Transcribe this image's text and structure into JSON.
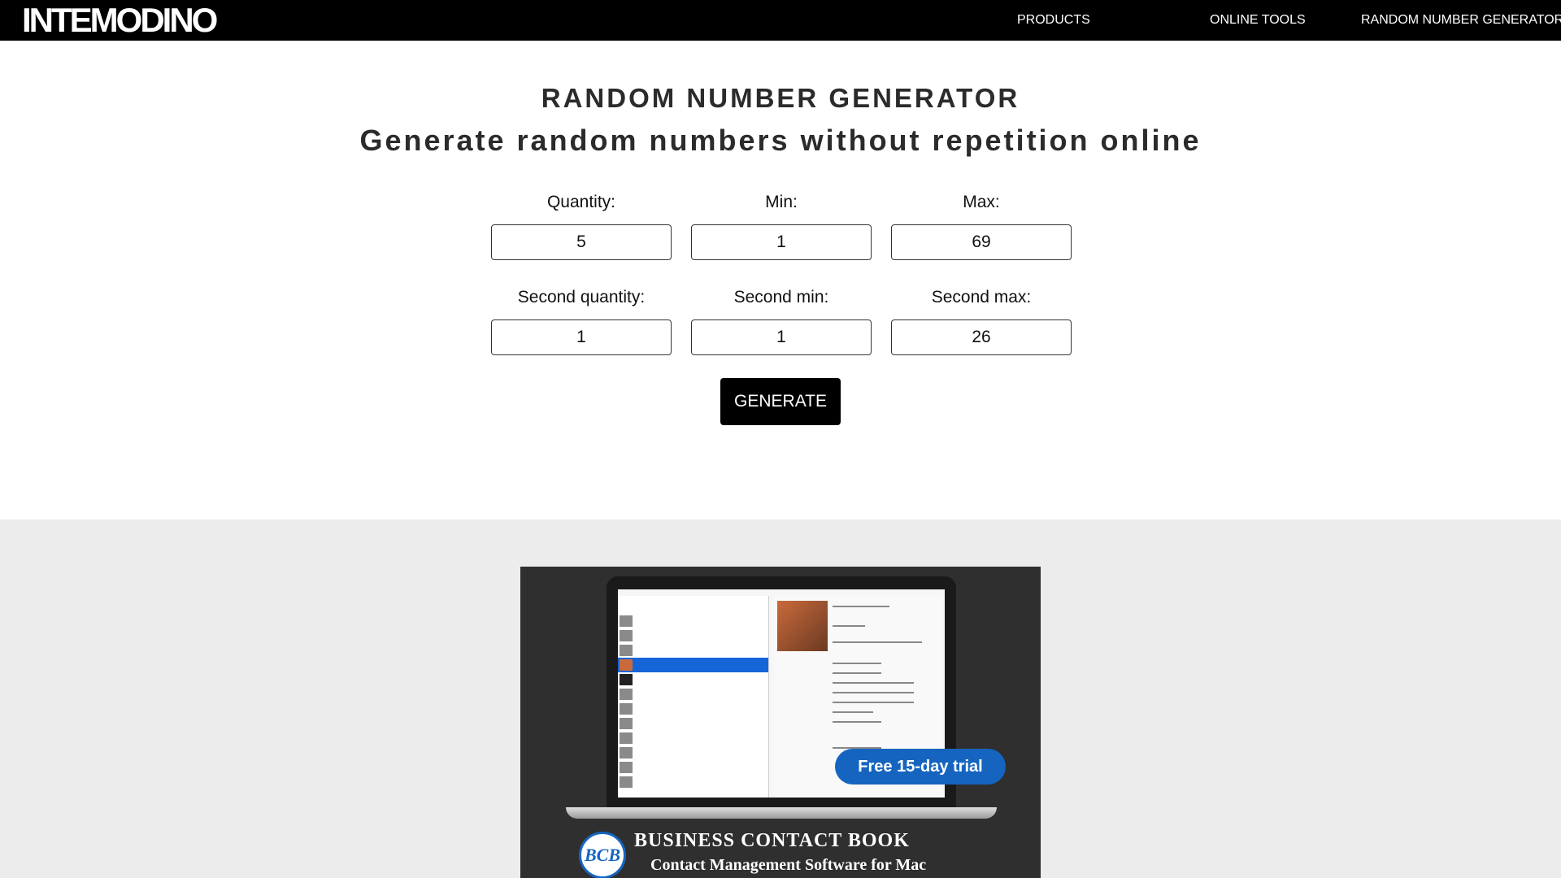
{
  "header": {
    "logo": "INTEMODINO",
    "nav": [
      "PRODUCTS",
      "ONLINE TOOLS",
      "RANDOM NUMBER GENERATOR"
    ]
  },
  "main": {
    "title": "RANDOM NUMBER GENERATOR",
    "subtitle": "Generate random numbers without repetition online",
    "fields": [
      {
        "label": "Quantity:",
        "value": "5"
      },
      {
        "label": "Min:",
        "value": "1"
      },
      {
        "label": "Max:",
        "value": "69"
      },
      {
        "label": "Second quantity:",
        "value": "1"
      },
      {
        "label": "Second min:",
        "value": "1"
      },
      {
        "label": "Second max:",
        "value": "26"
      }
    ],
    "generate_label": "GENERATE"
  },
  "ad": {
    "trial_label": "Free 15-day trial",
    "logo_text": "BCB",
    "product_title": "BUSINESS CONTACT BOOK",
    "product_subtitle": "Contact Management Software for Mac"
  }
}
